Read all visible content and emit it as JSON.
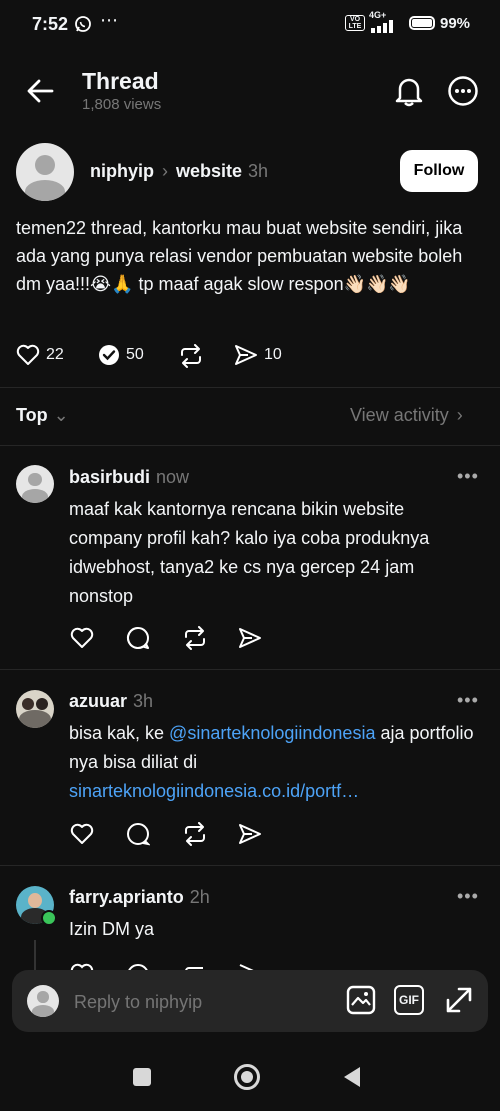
{
  "status_bar": {
    "time": "7:52",
    "battery": "99%",
    "network": "4G+"
  },
  "header": {
    "title": "Thread",
    "views": "1,808 views"
  },
  "post": {
    "author": "niphyip",
    "community": "website",
    "time": "3h",
    "follow_label": "Follow",
    "text": "temen22 thread, kantorku mau buat website sendiri, jika ada yang punya relasi vendor pembuatan website boleh dm yaa!!!😭🙏 tp maaf agak slow respon👋🏻👋🏻👋🏻",
    "likes": "22",
    "reposts_quotes": "50",
    "shares": "10"
  },
  "sort": {
    "label": "Top",
    "view_activity": "View activity"
  },
  "replies": [
    {
      "author": "basirbudi",
      "time": "now",
      "text": "maaf kak kantornya rencana bikin website company profil kah? kalo iya coba produknya idwebhost, tanya2 ke cs nya gercep 24 jam nonstop"
    },
    {
      "author": "azuuar",
      "time": "3h",
      "text_prefix": "bisa kak, ke ",
      "mention": "@sinarteknologiindonesia",
      "text_middle": " aja portfolio nya bisa diliat di ",
      "link": "sinarteknologiindonesia.co.id/portf…"
    },
    {
      "author": "farry.aprianto",
      "time": "2h",
      "text": "Izin DM ya"
    }
  ],
  "composer": {
    "placeholder": "Reply to niphyip",
    "gif_label": "GIF"
  },
  "colors": {
    "background": "#101010",
    "link": "#4da3f7",
    "muted": "#777777"
  }
}
